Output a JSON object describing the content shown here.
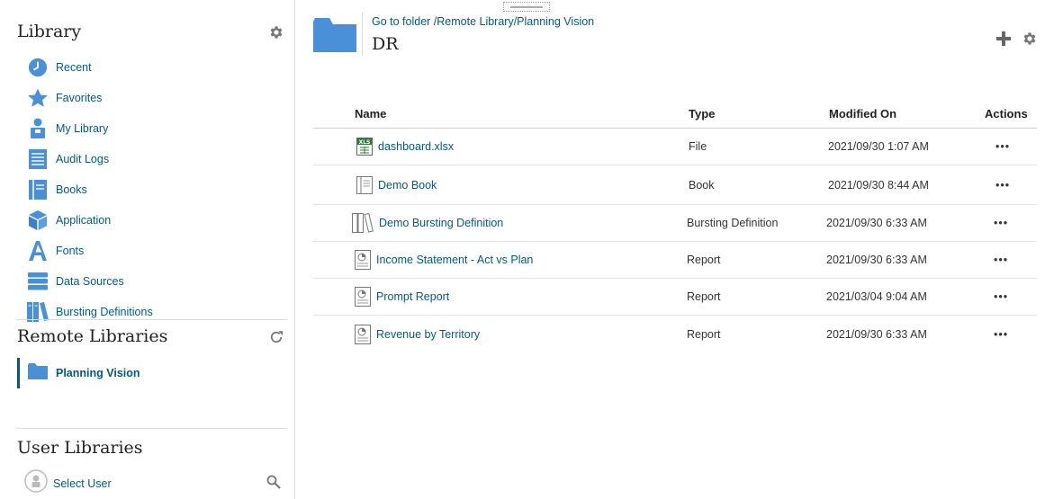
{
  "sidebar": {
    "library_title": "Library",
    "nav_items": [
      {
        "label": "Recent",
        "icon": "clock-icon"
      },
      {
        "label": "Favorites",
        "icon": "star-icon"
      },
      {
        "label": "My Library",
        "icon": "user-icon"
      },
      {
        "label": "Audit Logs",
        "icon": "document-lines-icon"
      },
      {
        "label": "Books",
        "icon": "book-icon"
      },
      {
        "label": "Application",
        "icon": "cube-icon"
      },
      {
        "label": "Fonts",
        "icon": "font-icon"
      },
      {
        "label": "Data Sources",
        "icon": "database-icon"
      },
      {
        "label": "Bursting Definitions",
        "icon": "binders-icon"
      }
    ],
    "remote_title": "Remote Libraries",
    "remote_items": [
      {
        "label": "Planning Vision",
        "icon": "folder-icon"
      }
    ],
    "user_title": "User Libraries",
    "user_select_label": "Select User"
  },
  "header": {
    "breadcrumb": "Go to folder /Remote Library/Planning Vision",
    "folder_title": "DR"
  },
  "table": {
    "columns": [
      "Name",
      "Type",
      "Modified On",
      "Actions"
    ],
    "rows": [
      {
        "name": "dashboard.xlsx",
        "type": "File",
        "modified": "2021/09/30 1:07 AM",
        "icon": "xls-icon",
        "action": "•••"
      },
      {
        "name": "Demo Book",
        "type": "Book",
        "modified": "2021/09/30 8:44 AM",
        "icon": "book-icon",
        "action": "•••"
      },
      {
        "name": "Demo Bursting Definition",
        "type": "Bursting Definition",
        "modified": "2021/09/30 6:33 AM",
        "icon": "bursting-icon",
        "action": "•••"
      },
      {
        "name": "Income Statement - Act vs Plan",
        "type": "Report",
        "modified": "2021/09/30 6:33 AM",
        "icon": "report-icon",
        "action": "•••"
      },
      {
        "name": "Prompt Report",
        "type": "Report",
        "modified": "2021/03/04 9:04 AM",
        "icon": "report-icon",
        "action": "•••"
      },
      {
        "name": "Revenue by Territory",
        "type": "Report",
        "modified": "2021/09/30 6:33 AM",
        "icon": "report-icon",
        "action": "•••"
      }
    ]
  },
  "colors": {
    "accent": "#00598a",
    "icon_blue": "#4a90d9",
    "divider": "#dcdcdc"
  }
}
